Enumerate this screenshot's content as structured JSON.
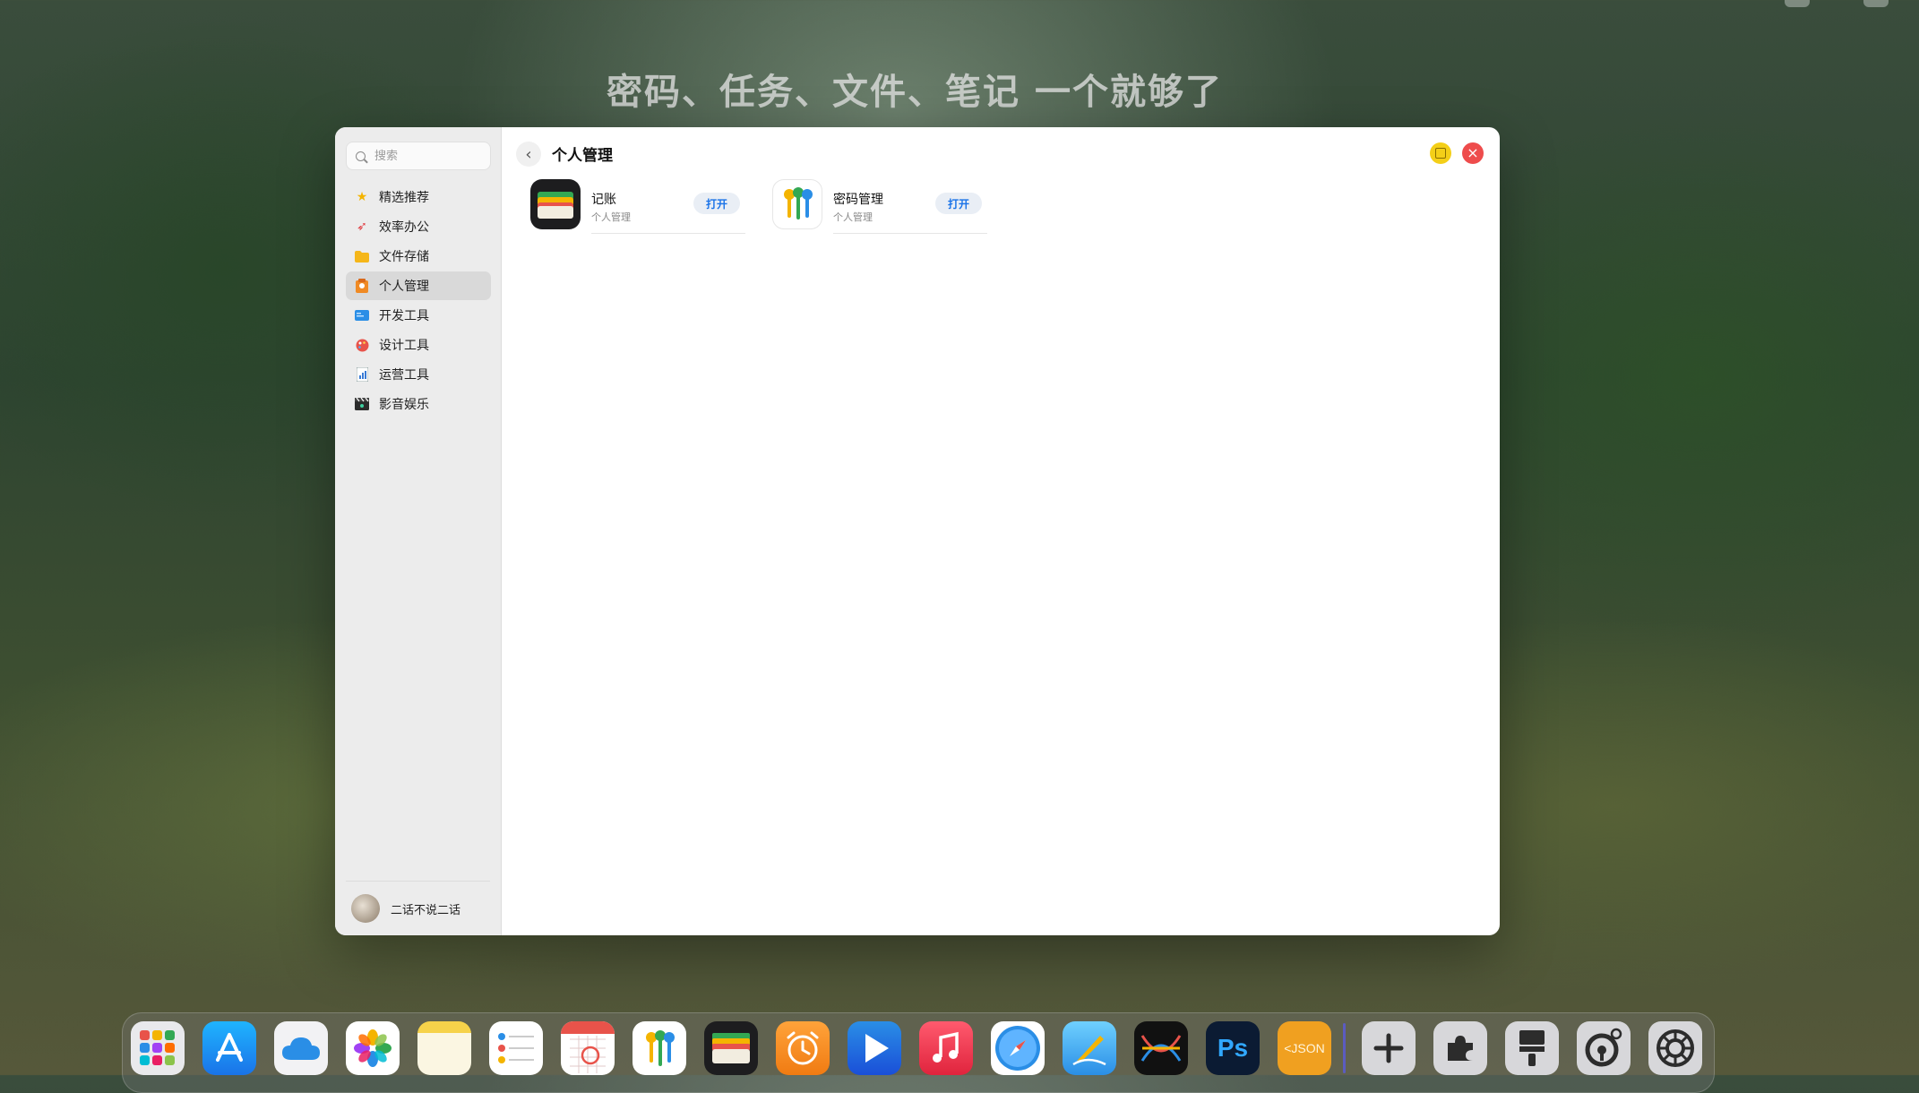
{
  "headline": "密码、任务、文件、笔记 一个就够了",
  "sidebar": {
    "search_placeholder": "搜索",
    "items": [
      {
        "label": "精选推荐",
        "icon": "star-icon"
      },
      {
        "label": "效率办公",
        "icon": "rocket-icon"
      },
      {
        "label": "文件存储",
        "icon": "folder-icon"
      },
      {
        "label": "个人管理",
        "icon": "person-icon",
        "active": true
      },
      {
        "label": "开发工具",
        "icon": "developer-icon"
      },
      {
        "label": "设计工具",
        "icon": "palette-icon"
      },
      {
        "label": "运营工具",
        "icon": "report-icon"
      },
      {
        "label": "影音娱乐",
        "icon": "clapper-icon"
      }
    ],
    "user": {
      "name": "二话不说二话"
    }
  },
  "main": {
    "title": "个人管理",
    "apps": [
      {
        "name": "记账",
        "category": "个人管理",
        "action": "打开",
        "icon": "wallet-icon"
      },
      {
        "name": "密码管理",
        "category": "个人管理",
        "action": "打开",
        "icon": "keys-icon"
      }
    ]
  },
  "window_controls": {
    "close_glyph": "×",
    "back_glyph": "‹"
  },
  "dock": {
    "items": [
      "launchpad-icon",
      "app-store-icon",
      "icloud-icon",
      "photos-icon",
      "notes-icon",
      "reminders-icon",
      "calendar-icon",
      "passwords-icon",
      "wallet-icon",
      "clock-icon",
      "video-icon",
      "music-icon",
      "safari-icon",
      "freeform-icon",
      "dev-tool-icon",
      "photoshop-icon",
      "json-icon",
      "add-icon",
      "extensions-icon",
      "brush-icon",
      "settings-icon",
      "system-icon"
    ],
    "ps_label": "Ps",
    "json_label": "<JSON"
  },
  "colors": {
    "accent": "#1a73e8",
    "close": "#ee4c4c",
    "minimize": "#f4cf18"
  }
}
